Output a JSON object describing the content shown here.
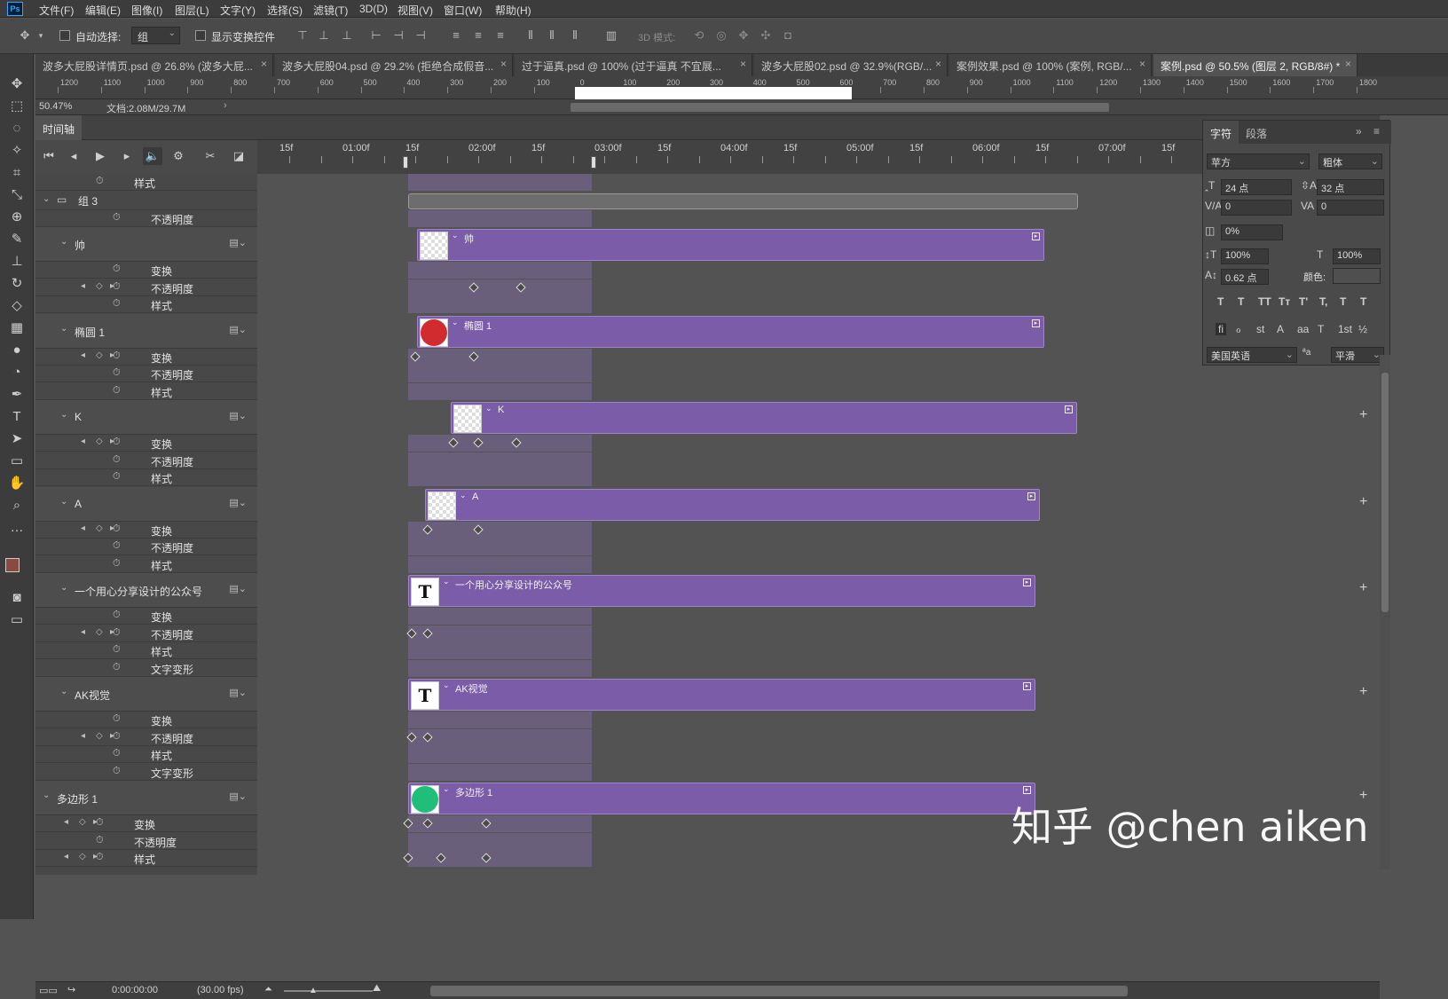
{
  "app": {
    "logo": "Ps"
  },
  "menu": [
    "文件(F)",
    "编辑(E)",
    "图像(I)",
    "图层(L)",
    "文字(Y)",
    "选择(S)",
    "滤镜(T)",
    "3D(D)",
    "视图(V)",
    "窗口(W)",
    "帮助(H)"
  ],
  "options": {
    "auto_select_label": "自动选择:",
    "auto_select_value": "组",
    "show_transform_label": "显示变换控件",
    "mode3d_label": "3D 模式:"
  },
  "tabs": [
    {
      "label": "波多大屁股详情页.psd @ 26.8% (波多大屁..."
    },
    {
      "label": "波多大屁股04.psd @ 29.2% (拒绝合成假音..."
    },
    {
      "label": "过于逼真.psd @ 100% (过于逼真 不宜展..."
    },
    {
      "label": "波多大屁股02.psd @ 32.9%(RGB/..."
    },
    {
      "label": "案例效果.psd @ 100% (案例, RGB/..."
    },
    {
      "label": "案例.psd @ 50.5% (图层 2, RGB/8#) *"
    }
  ],
  "ruler_labels": [
    "1200",
    "1100",
    "1000",
    "900",
    "800",
    "700",
    "600",
    "500",
    "400",
    "300",
    "200",
    "100",
    "0",
    "100",
    "200",
    "300",
    "400",
    "500",
    "600",
    "700",
    "800",
    "900",
    "1000",
    "1100",
    "1200",
    "1300",
    "1400",
    "1500",
    "1600",
    "1700",
    "1800"
  ],
  "status": {
    "zoom": "50.47%",
    "doc": "文档:2.08M/29.7M"
  },
  "timeline": {
    "panel_title": "时间轴",
    "time_labels": [
      "15f",
      "01:00f",
      "15f",
      "02:00f",
      "15f",
      "03:00f",
      "15f",
      "04:00f",
      "15f",
      "05:00f",
      "15f",
      "06:00f",
      "15f",
      "07:00f",
      "15f"
    ],
    "current_time": "0:00:00:00",
    "fps": "(30.00 fps)",
    "rows": {
      "style": "样式",
      "group3": "组 3",
      "opacity": "不透明度",
      "transform": "变换",
      "text_warp": "文字变形"
    },
    "layers": [
      {
        "name": "帅",
        "bar_label": "帅"
      },
      {
        "name": "椭圆 1",
        "bar_label": "椭圆 1"
      },
      {
        "name": "K",
        "bar_label": "K"
      },
      {
        "name": "A",
        "bar_label": "A"
      },
      {
        "name": "一个用心分享设计的公众号",
        "bar_label": "一个用心分享设计的公众号"
      },
      {
        "name": "AK视觉",
        "bar_label": "AK视觉"
      },
      {
        "name": "多边形 1",
        "bar_label": "多边形 1"
      }
    ]
  },
  "character_panel": {
    "tab_char": "字符",
    "tab_para": "段落",
    "font_family": "苹方",
    "font_style": "粗体",
    "font_size": "24 点",
    "leading": "32 点",
    "kerning": "0",
    "tracking": "0",
    "tsume": "0%",
    "vscale": "100%",
    "hscale": "100%",
    "baseline": "0.62 点",
    "color_label": "颜色:",
    "language": "美国英语",
    "aa_label": "ªa",
    "antialias": "平滑",
    "style_buttons": [
      "T",
      "T",
      "TT",
      "Tт",
      "T'",
      "T,",
      "T",
      "T"
    ],
    "ot_buttons": [
      "fi",
      "ℴ",
      "st",
      "A",
      "aa",
      "T",
      "1st",
      "½"
    ]
  },
  "watermark": "知乎 @chen aiken",
  "colors": {
    "bar": "#7b5ca8",
    "ellipse": "#d12a2f",
    "polygon": "#1fbf7a",
    "fg": "#8a4a44"
  }
}
